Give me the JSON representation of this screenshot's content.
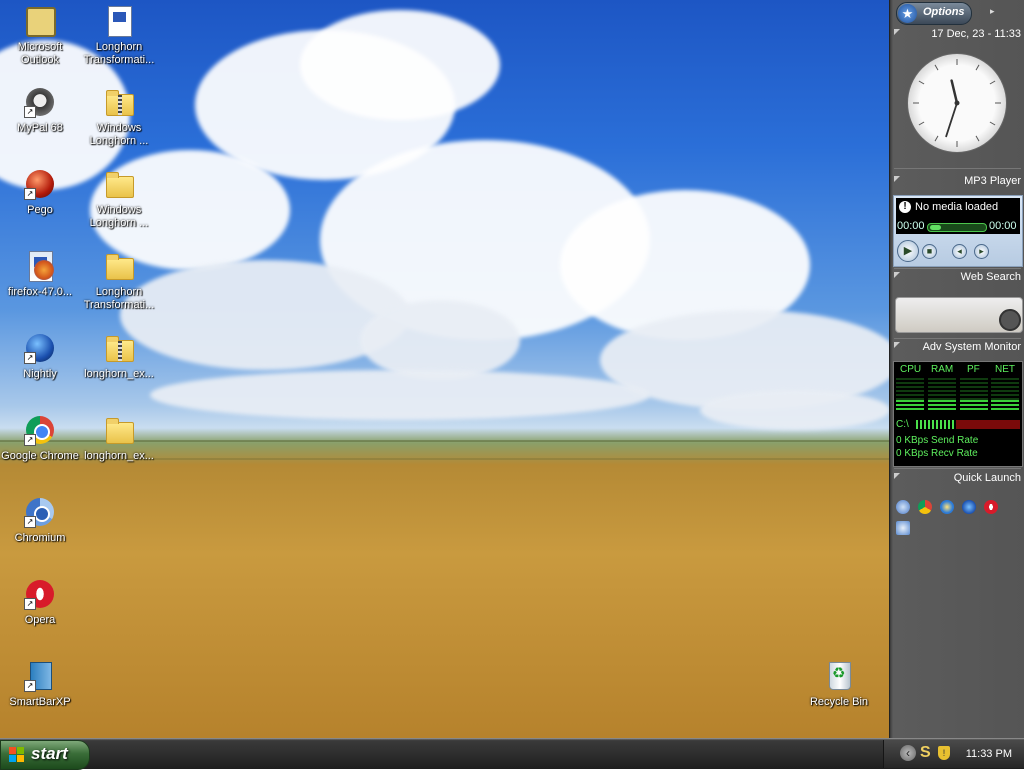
{
  "desktop": {
    "icons": [
      {
        "label": "Microsoft\nOutlook"
      },
      {
        "label": "Longhorn\nTransformati..."
      },
      {
        "label": "MyPal 68"
      },
      {
        "label": "Windows\nLonghorn ..."
      },
      {
        "label": "Pego"
      },
      {
        "label": "Windows\nLonghorn ..."
      },
      {
        "label": "firefox-47.0..."
      },
      {
        "label": "Longhorn\nTransformati..."
      },
      {
        "label": "Nightly"
      },
      {
        "label": "longhorn_ex..."
      },
      {
        "label": "Google Chrome"
      },
      {
        "label": "longhorn_ex..."
      },
      {
        "label": "Chromium"
      },
      {
        "label": "Opera"
      },
      {
        "label": "SmartBarXP"
      },
      {
        "label": "Recycle Bin"
      }
    ]
  },
  "sidebar": {
    "options_label": "Options",
    "datetime": "17 Dec, 23 - 11:33",
    "clock": {
      "hour": 11,
      "minute": 33
    },
    "mp3": {
      "title": "MP3 Player",
      "status": "No media loaded",
      "time_elapsed": "00:00",
      "time_total": "00:00"
    },
    "web_search": {
      "title": "Web Search"
    },
    "monitor": {
      "title": "Adv System Monitor",
      "cols": [
        "CPU",
        "RAM",
        "PF",
        "NET"
      ],
      "drive": "C:\\",
      "send": "0 KBps Send Rate",
      "recv": "0 KBps Recv Rate"
    },
    "quick_launch": {
      "title": "Quick Launch"
    }
  },
  "taskbar": {
    "start_label": "start",
    "time": "11:33 PM"
  }
}
